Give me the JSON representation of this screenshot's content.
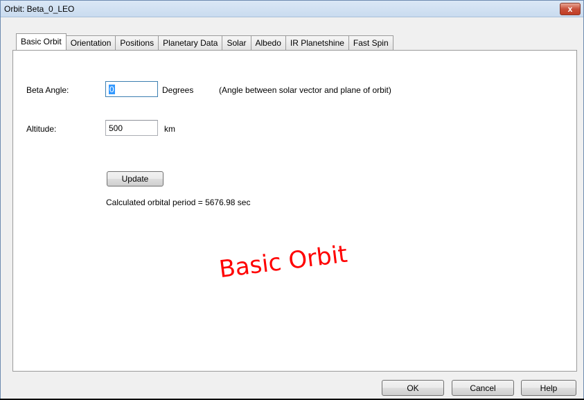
{
  "window": {
    "title": "Orbit: Beta_0_LEO",
    "close_glyph": "x"
  },
  "tabs": [
    {
      "label": "Basic Orbit",
      "active": true
    },
    {
      "label": "Orientation",
      "active": false
    },
    {
      "label": "Positions",
      "active": false
    },
    {
      "label": "Planetary Data",
      "active": false
    },
    {
      "label": "Solar",
      "active": false
    },
    {
      "label": "Albedo",
      "active": false
    },
    {
      "label": "IR Planetshine",
      "active": false
    },
    {
      "label": "Fast Spin",
      "active": false
    }
  ],
  "form": {
    "beta_angle": {
      "label": "Beta Angle:",
      "value": "0",
      "unit": "Degrees",
      "note": "(Angle between solar vector and plane of orbit)"
    },
    "altitude": {
      "label": "Altitude:",
      "value": "500",
      "unit": "km"
    },
    "update_label": "Update",
    "result_text": "Calculated orbital period = 5676.98 sec"
  },
  "annotation": "Basic Orbit",
  "buttons": {
    "ok": "OK",
    "cancel": "Cancel",
    "help": "Help"
  },
  "colors": {
    "annotation": "#ff0000",
    "close_button": "#c8503a",
    "selection": "#3399ff"
  }
}
